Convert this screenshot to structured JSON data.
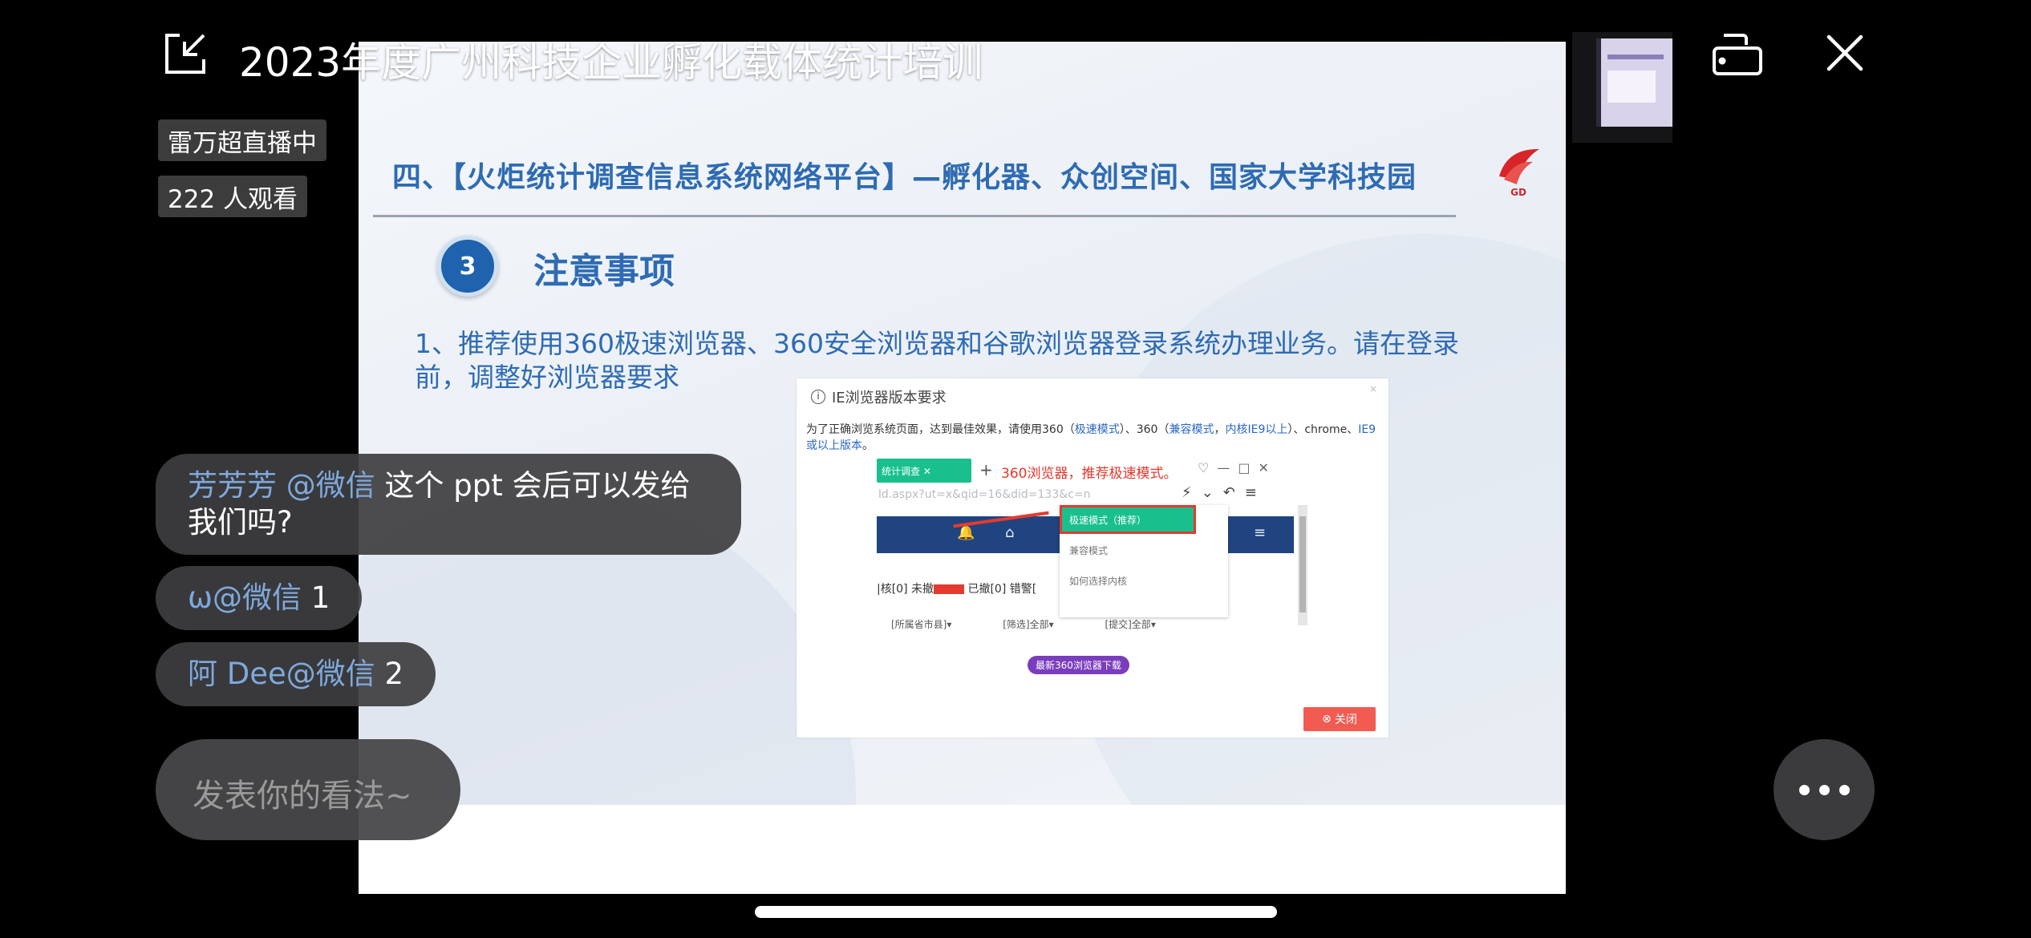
{
  "header": {
    "title": "2023年度广州科技企业孵化载体统计培训",
    "pip_icon": "minimize-window-icon",
    "rotate_icon": "rotate-screen-icon",
    "close_icon": "close-icon"
  },
  "live": {
    "host_status": "雷万超直播中",
    "viewers": "222 人观看"
  },
  "slide": {
    "heading": "四、【火炬统计调查信息系统网络平台】—孵化器、众创空间、国家大学科技园",
    "step_number": "3",
    "step_title": "注意事项",
    "body": "1、推荐使用360极速浏览器、360安全浏览器和谷歌浏览器登录系统办理业务。请在登录前，调整好浏览器要求",
    "dialog": {
      "title": "IE浏览器版本要求",
      "desc_prefix": "为了正确浏览系统页面，达到最佳效果，请使用360（",
      "desc_fast": "极速模式",
      "desc_mid": "）、360（",
      "desc_compat": "兼容模式",
      "desc_comma": "，",
      "desc_kernel": "内核IE9以上",
      "desc_mid2": "）、chrome、",
      "desc_ie": "IE9或以上版本",
      "desc_end": "。",
      "tab_label": "统计调查",
      "promo": "360浏览器，推荐极速模式。",
      "url": "ld.aspx?ut=x&qid=16&did=133&c=n",
      "menu_selected": "极速模式（推荐）",
      "menu_compat": "兼容模式",
      "menu_howto": "如何选择内核",
      "row1_a": "|核[0] 未撤",
      "row1_b": "已撤[0] 错警[",
      "filter_city": "[所属省市县]",
      "filter_filter": "[筛选]全部",
      "filter_submit": "[提交]全部",
      "download": "最新360浏览器下载",
      "close": "关闭"
    }
  },
  "chat": {
    "messages": [
      {
        "user": "芳芳芳 @微信",
        "text": " 这个 ppt 会后可以发给我们吗?"
      },
      {
        "user": "ω@微信",
        "text": " 1"
      },
      {
        "user": "阿 Dee@微信",
        "text": " 2"
      }
    ],
    "input_placeholder": "发表你的看法~"
  },
  "colors": {
    "background": "#000000",
    "chat_user": "#7fa9dc",
    "slide_blue": "#2e6bb3",
    "accent_red": "#e33b2f",
    "accent_green": "#19c08d"
  }
}
